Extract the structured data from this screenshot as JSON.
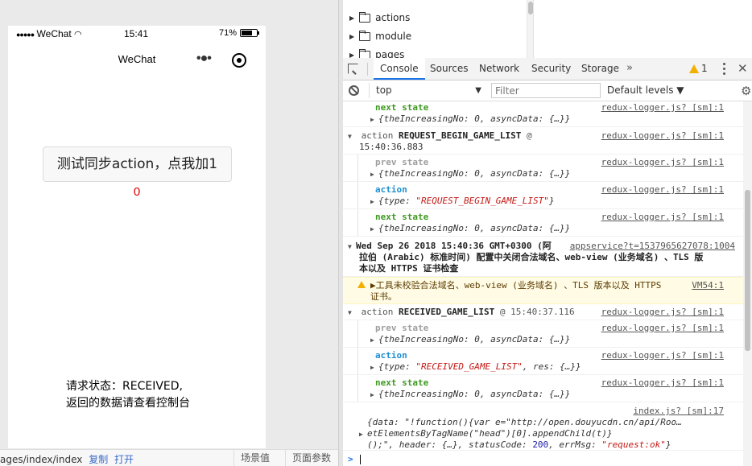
{
  "simulator": {
    "status_bar": {
      "signal": "●●●●●",
      "carrier": "WeChat",
      "time": "15:41",
      "battery_percent": "71%",
      "battery_level": 0.71
    },
    "nav_title": "WeChat",
    "sync_button_label": "测试同步action，点我加1",
    "counter_value": "0",
    "request_status_line1": "请求状态：RECEIVED,",
    "request_status_line2": "返回的数据请查看控制台",
    "footer": {
      "path": "ages/index/index",
      "copy_label": "复制",
      "open_label": "打开",
      "scene_label": "场景值",
      "params_label": "页面参数"
    }
  },
  "file_tree": {
    "items": [
      {
        "label": "actions"
      },
      {
        "label": "module"
      },
      {
        "label": "pages"
      }
    ]
  },
  "devtools": {
    "tabs": [
      "Console",
      "Sources",
      "Network",
      "Security",
      "Storage"
    ],
    "more_tabs": "»",
    "warning_count": "1",
    "context": "top",
    "filter_placeholder": "Filter",
    "levels_label": "Default levels ▼",
    "colors": {
      "next_state": "#3e9a1f",
      "prev_state": "#9e9e9e",
      "action": "#1e90d4",
      "warning_bg": "#fffbe5",
      "counter": "#e00000"
    },
    "logs": {
      "r1_label": "next state",
      "r1_src": "redux-logger.js? [sm]:1",
      "r1_obj": "{theIncreasingNo: 0, asyncData: {…}}",
      "g1_action": "action",
      "g1_name": "REQUEST_BEGIN_GAME_LIST",
      "g1_at": "@",
      "g1_time": "15:40:36.883",
      "g1_src": "redux-logger.js? [sm]:1",
      "r2_label": "prev state",
      "r2_src": "redux-logger.js? [sm]:1",
      "r2_obj": "{theIncreasingNo: 0, asyncData: {…}}",
      "r3_label": "action",
      "r3_src": "redux-logger.js? [sm]:1",
      "r3_key": "{type: ",
      "r3_val": "\"REQUEST_BEGIN_GAME_LIST\"",
      "r3_end": "}",
      "r4_label": "next state",
      "r4_src": "redux-logger.js? [sm]:1",
      "r4_obj": "{theIncreasingNo: 0, asyncData: {…}}",
      "d1_line1": "Wed Sep 26 2018 15:40:36 GMT+0300 (阿",
      "d1_src": "appservice?t=1537965627078:1004",
      "d1_line2": "拉伯 (Arabic) 标准时间) 配置中关闭合法域名、web-view (业务域名) 、TLS 版",
      "d1_line3": "本以及 HTTPS 证书检查",
      "w1_line1": "▶工具未校验合法域名、web-view (业务域名) 、TLS 版本以及 HTTPS",
      "w1_line2": "证书。",
      "w1_src": "VM54:1",
      "g2_action": "action",
      "g2_name": "RECEIVED_GAME_LIST",
      "g2_at": "@",
      "g2_time": "15:40:37.116",
      "g2_src": "redux-logger.js? [sm]:1",
      "r5_label": "prev state",
      "r5_src": "redux-logger.js? [sm]:1",
      "r5_obj": "{theIncreasingNo: 0, asyncData: {…}}",
      "r6_label": "action",
      "r6_src": "redux-logger.js? [sm]:1",
      "r6_key": "{type: ",
      "r6_val": "\"RECEIVED_GAME_LIST\"",
      "r6_end": ", res: {…}}",
      "r7_label": "next state",
      "r7_src": "redux-logger.js? [sm]:1",
      "r7_obj": "{theIncreasingNo: 0, asyncData: {…}}",
      "i1_src": "index.js? [sm]:17",
      "i1_line1": "{data: \"!function(){var e=\"http://open.douyucdn.cn/api/Roo…",
      "i1_line2": "etElementsByTagName(\"head\")[0].appendChild(t)}",
      "i1_line3a": "();\", header: {…}, statusCode: ",
      "i1_code": "200",
      "i1_line3b": ", errMsg: ",
      "i1_msg": "\"request:ok\"",
      "i1_line3c": "}",
      "prompt": ">"
    }
  }
}
